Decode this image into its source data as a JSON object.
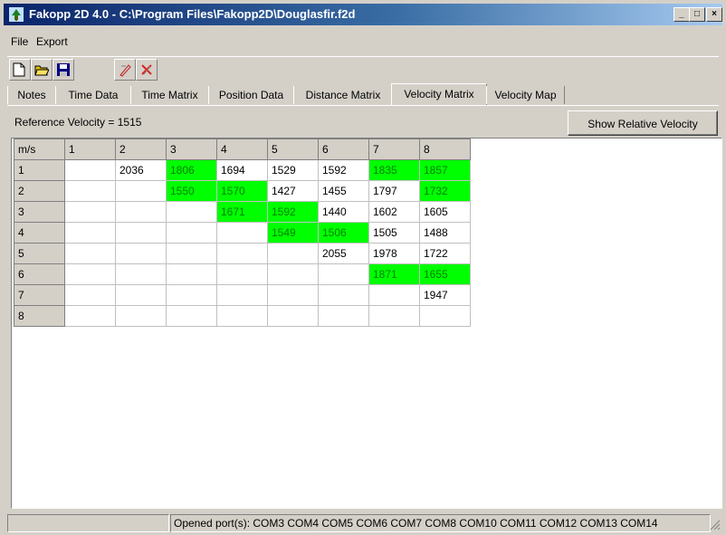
{
  "window": {
    "title": "Fakopp 2D 4.0 - C:\\Program Files\\Fakopp2D\\Douglasfir.f2d",
    "buttons": {
      "minimize": "_",
      "maximize": "□",
      "close": "×"
    }
  },
  "menu": {
    "file": "File",
    "export": "Export"
  },
  "toolbar": {
    "icons": [
      "new-file-icon",
      "open-folder-icon",
      "save-icon",
      "pencil-measure-icon",
      "delete-measure-icon"
    ]
  },
  "tabs": [
    "Notes",
    "Time Data",
    "Time Matrix",
    "Position Data",
    "Distance Matrix",
    "Velocity Matrix",
    "Velocity Map"
  ],
  "active_tab": "Velocity Matrix",
  "reference_velocity_label": "Reference Velocity = 1515",
  "show_relative_button": "Show Relative Velocity",
  "grid": {
    "corner": "m/s",
    "col_headers": [
      "1",
      "2",
      "3",
      "4",
      "5",
      "6",
      "7",
      "8"
    ],
    "row_headers": [
      "1",
      "2",
      "3",
      "4",
      "5",
      "6",
      "7",
      "8"
    ],
    "rows": [
      [
        "",
        "2036",
        "1806",
        "1694",
        "1529",
        "1592",
        "1835",
        "1857"
      ],
      [
        "",
        "",
        "1550",
        "1570",
        "1427",
        "1455",
        "1797",
        "1732"
      ],
      [
        "",
        "",
        "",
        "1671",
        "1592",
        "1440",
        "1602",
        "1605"
      ],
      [
        "",
        "",
        "",
        "",
        "1549",
        "1506",
        "1505",
        "1488"
      ],
      [
        "",
        "",
        "",
        "",
        "",
        "2055",
        "1978",
        "1722"
      ],
      [
        "",
        "",
        "",
        "",
        "",
        "",
        "1871",
        "1655"
      ],
      [
        "",
        "",
        "",
        "",
        "",
        "",
        "",
        "1947"
      ],
      [
        "",
        "",
        "",
        "",
        "",
        "",
        "",
        ""
      ]
    ],
    "highlighted": [
      [
        false,
        false,
        true,
        false,
        false,
        false,
        true,
        true
      ],
      [
        false,
        false,
        true,
        true,
        false,
        false,
        false,
        true
      ],
      [
        false,
        false,
        false,
        true,
        true,
        false,
        false,
        false
      ],
      [
        false,
        false,
        false,
        false,
        true,
        true,
        false,
        false
      ],
      [
        false,
        false,
        false,
        false,
        false,
        false,
        false,
        false
      ],
      [
        false,
        false,
        false,
        false,
        false,
        false,
        true,
        true
      ],
      [
        false,
        false,
        false,
        false,
        false,
        false,
        false,
        false
      ],
      [
        false,
        false,
        false,
        false,
        false,
        false,
        false,
        false
      ]
    ],
    "highlight_color": "#00ff00",
    "highlight_text_color": "#008000"
  },
  "status": {
    "pane1": "",
    "ports": "Opened port(s):  COM3 COM4 COM5 COM6 COM7 COM8 COM10 COM11 COM12 COM13 COM14"
  }
}
